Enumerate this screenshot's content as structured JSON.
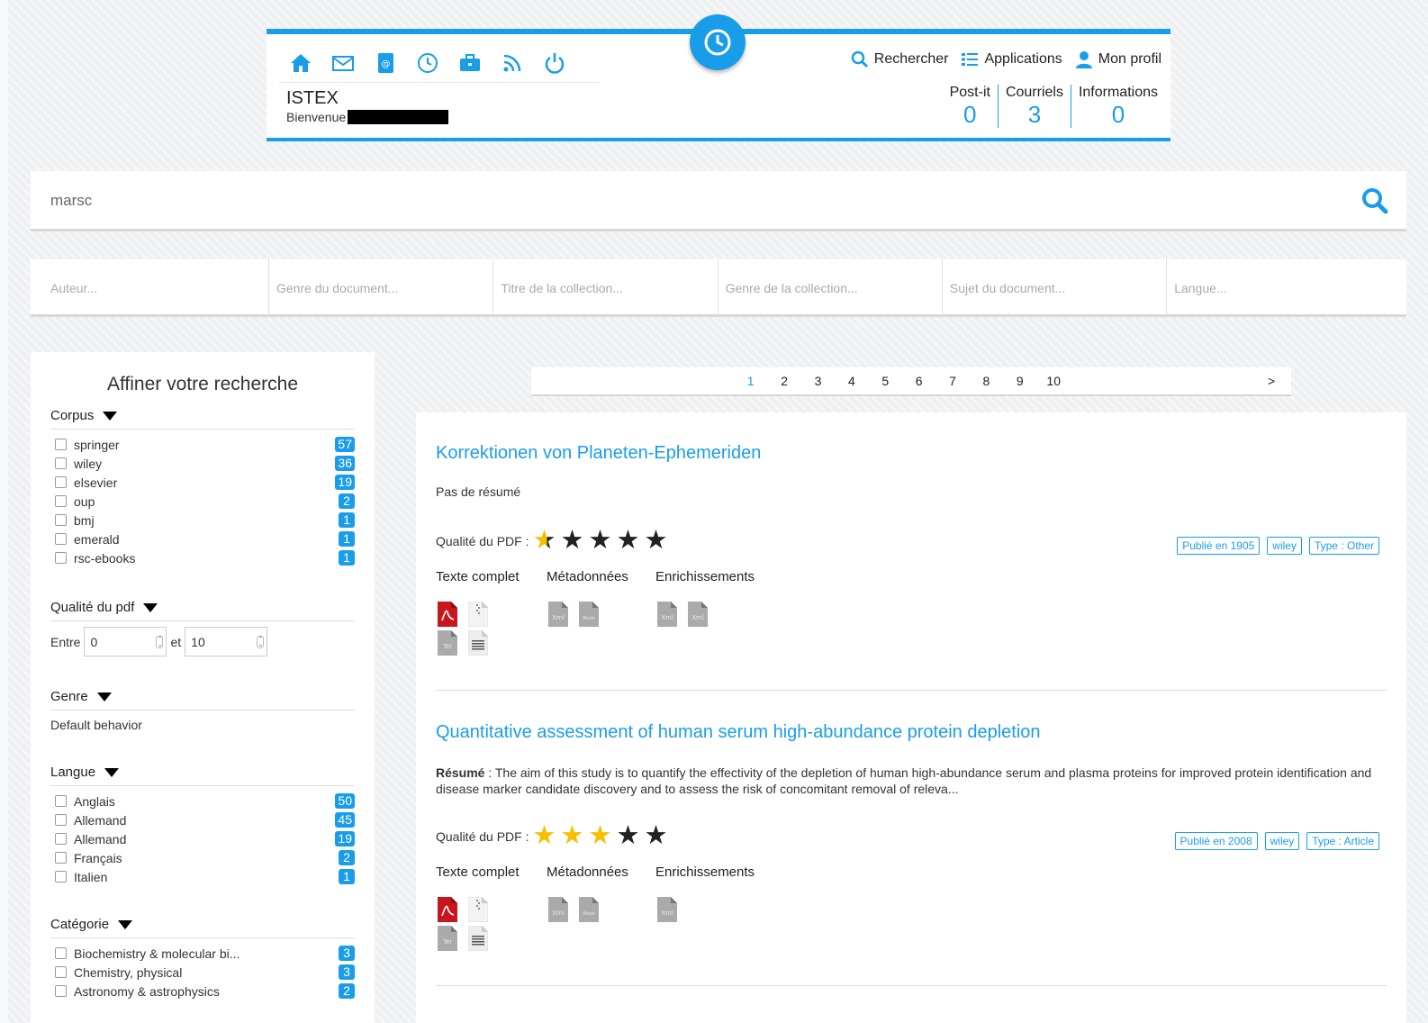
{
  "header": {
    "brand": "ISTEX",
    "welcome": "Bienvenue",
    "links": {
      "search": "Rechercher",
      "apps": "Applications",
      "profile": "Mon profil"
    },
    "counters": [
      {
        "label": "Post-it",
        "value": "0"
      },
      {
        "label": "Courriels",
        "value": "3"
      },
      {
        "label": "Informations",
        "value": "0"
      }
    ],
    "accent": "#1a9de8"
  },
  "search": {
    "value": "marsc"
  },
  "filters": {
    "author": "Auteur...",
    "doc_genre": "Genre du document...",
    "collection_title": "Titre de la collection...",
    "collection_genre": "Genre de la collection...",
    "subject": "Sujet du document...",
    "language": "Langue..."
  },
  "sidebar": {
    "title": "Affiner votre recherche",
    "corpus": {
      "label": "Corpus",
      "items": [
        {
          "label": "springer",
          "count": "57"
        },
        {
          "label": "wiley",
          "count": "36"
        },
        {
          "label": "elsevier",
          "count": "19"
        },
        {
          "label": "oup",
          "count": "2"
        },
        {
          "label": "bmj",
          "count": "1"
        },
        {
          "label": "emerald",
          "count": "1"
        },
        {
          "label": "rsc-ebooks",
          "count": "1"
        }
      ]
    },
    "quality": {
      "label": "Qualité du pdf",
      "between": "Entre",
      "and": "et",
      "min": "0",
      "max": "10"
    },
    "genre": {
      "label": "Genre",
      "default": "Default behavior"
    },
    "language": {
      "label": "Langue",
      "items": [
        {
          "label": "Anglais",
          "count": "50"
        },
        {
          "label": "Allemand",
          "count": "45"
        },
        {
          "label": "Allemand",
          "count": "19"
        },
        {
          "label": "Français",
          "count": "2"
        },
        {
          "label": "Italien",
          "count": "1"
        }
      ]
    },
    "category": {
      "label": "Catégorie",
      "items": [
        {
          "label": "Biochemistry & molecular bi...",
          "count": "3"
        },
        {
          "label": "Chemistry, physical",
          "count": "3"
        },
        {
          "label": "Astronomy & astrophysics",
          "count": "2"
        }
      ]
    }
  },
  "pagination": {
    "pages": [
      "1",
      "2",
      "3",
      "4",
      "5",
      "6",
      "7",
      "8",
      "9",
      "10"
    ],
    "current": "1",
    "next": ">"
  },
  "results": [
    {
      "title": "Korrektionen von Planeten-Ephemeriden",
      "summary_label": "",
      "summary": "Pas de résumé",
      "quality_label": "Qualité du PDF :",
      "stars_filled": 0.5,
      "tags": [
        "Publié en 1905",
        "wiley",
        "Type : Other"
      ],
      "sections": {
        "fulltext": "Texte complet",
        "metadata": "Métadonnées",
        "enrichments": "Enrichissements"
      },
      "icons": {
        "fulltext": [
          "pdf-icon",
          "zip-icon",
          "tei-icon",
          "txt-icon"
        ],
        "metadata": [
          "Xml",
          "Mods"
        ],
        "enrichments": [
          "Xml",
          "Xml"
        ],
        "tei": "Tei"
      }
    },
    {
      "title": "Quantitative assessment of human serum high-abundance protein depletion",
      "summary_label": "Résumé",
      "summary": " : The aim of this study is to quantify the effectivity of the depletion of human high-abundance serum and plasma proteins for improved protein identification and disease marker candidate discovery and to assess the risk of concomitant removal of releva...",
      "quality_label": "Qualité du PDF :",
      "stars_filled": 3,
      "tags": [
        "Publié en 2008",
        "wiley",
        "Type : Article"
      ],
      "sections": {
        "fulltext": "Texte complet",
        "metadata": "Métadonnées",
        "enrichments": "Enrichissements"
      },
      "icons": {
        "fulltext": [
          "pdf-icon",
          "zip-icon",
          "tei-icon",
          "txt-icon"
        ],
        "metadata": [
          "Xml",
          "Mods"
        ],
        "enrichments": [
          "Xml"
        ],
        "tei": "Tei"
      }
    }
  ]
}
